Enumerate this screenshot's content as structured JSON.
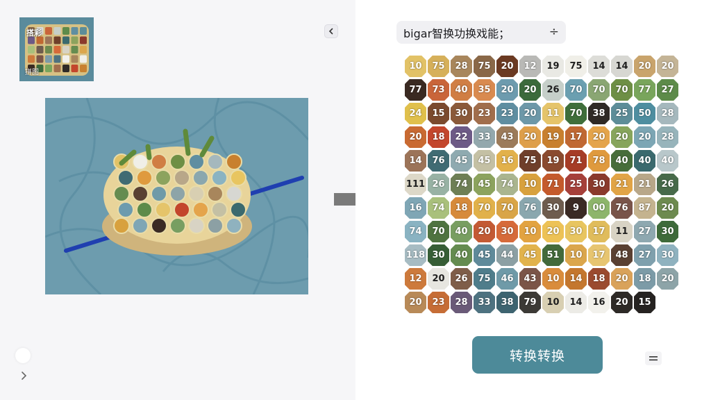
{
  "left_panel": {
    "thumbnail": {
      "caption_top": "搭彩",
      "caption_bottom": "拼图"
    }
  },
  "right_panel": {
    "pill": {
      "text": "bigar智换功换戏能；",
      "plus_icon": "plus-icon"
    },
    "convert_button": {
      "label": "转换转换"
    }
  },
  "bead_grid": {
    "rows": [
      [
        {
          "v": "10",
          "c": "#e2c267"
        },
        {
          "v": "75",
          "c": "#d6b05a"
        },
        {
          "v": "28",
          "c": "#a8865c"
        },
        {
          "v": "75",
          "c": "#8a6848"
        },
        {
          "v": "20",
          "c": "#6b3a22"
        },
        {
          "v": "12",
          "c": "#b9b9b6"
        },
        {
          "v": "19",
          "c": "#e9e9e4"
        },
        {
          "v": "75",
          "c": "#f0efe8"
        },
        {
          "v": "14",
          "c": "#ddddd8"
        },
        {
          "v": "14",
          "c": "#d7d7d2"
        },
        {
          "v": "20",
          "c": "#c9a46c"
        },
        {
          "v": "20",
          "c": "#c4b496"
        }
      ],
      [
        {
          "v": "77",
          "c": "#3a2a22"
        },
        {
          "v": "73",
          "c": "#c9653a"
        },
        {
          "v": "40",
          "c": "#d07e44"
        },
        {
          "v": "35",
          "c": "#d98a4f"
        },
        {
          "v": "20",
          "c": "#6d9bae"
        },
        {
          "v": "20",
          "c": "#3c6a3c"
        },
        {
          "v": "26",
          "c": "#c6cfc9"
        },
        {
          "v": "70",
          "c": "#6b9fb0"
        },
        {
          "v": "70",
          "c": "#8aa673"
        },
        {
          "v": "70",
          "c": "#6e8f45"
        },
        {
          "v": "77",
          "c": "#79a55c"
        },
        {
          "v": "27",
          "c": "#5d8b4a"
        }
      ],
      [
        {
          "v": "24",
          "c": "#e0c04c"
        },
        {
          "v": "15",
          "c": "#7b4a2e"
        },
        {
          "v": "30",
          "c": "#8b5a3a"
        },
        {
          "v": "23",
          "c": "#a16e4c"
        },
        {
          "v": "23",
          "c": "#5f8ea1"
        },
        {
          "v": "20",
          "c": "#6d98a8"
        },
        {
          "v": "11",
          "c": "#e5c46a"
        },
        {
          "v": "70",
          "c": "#3f6e3b"
        },
        {
          "v": "38",
          "c": "#2f2a26"
        },
        {
          "v": "25",
          "c": "#5d8d98"
        },
        {
          "v": "50",
          "c": "#4e8ea0"
        },
        {
          "v": "28",
          "c": "#a5b8bd"
        }
      ],
      [
        {
          "v": "20",
          "c": "#c96a32"
        },
        {
          "v": "18",
          "c": "#c3462c"
        },
        {
          "v": "22",
          "c": "#6d5a86"
        },
        {
          "v": "33",
          "c": "#93a8ad"
        },
        {
          "v": "43",
          "c": "#9c7b5a"
        },
        {
          "v": "20",
          "c": "#de9f4a"
        },
        {
          "v": "19",
          "c": "#c8802f"
        },
        {
          "v": "17",
          "c": "#c06832"
        },
        {
          "v": "20",
          "c": "#e4a44b"
        },
        {
          "v": "20",
          "c": "#87a55c"
        },
        {
          "v": "20",
          "c": "#7ca6b4"
        },
        {
          "v": "28",
          "c": "#97b4bb"
        }
      ],
      [
        {
          "v": "14",
          "c": "#9c7459"
        },
        {
          "v": "76",
          "c": "#406b73"
        },
        {
          "v": "45",
          "c": "#8faab0"
        },
        {
          "v": "45",
          "c": "#c4c0a4"
        },
        {
          "v": "16",
          "c": "#e2b14b"
        },
        {
          "v": "75",
          "c": "#6f3f2b"
        },
        {
          "v": "19",
          "c": "#8a4a2f"
        },
        {
          "v": "71",
          "c": "#a63c26"
        },
        {
          "v": "78",
          "c": "#df9a3e"
        },
        {
          "v": "40",
          "c": "#476d3a"
        },
        {
          "v": "40",
          "c": "#3b6a6e"
        },
        {
          "v": "40",
          "c": "#b8c7ca"
        }
      ],
      [
        {
          "v": "111",
          "c": "#ddd8c8"
        },
        {
          "v": "26",
          "c": "#98b2a4"
        },
        {
          "v": "74",
          "c": "#6e7f55"
        },
        {
          "v": "45",
          "c": "#8ca35e"
        },
        {
          "v": "74",
          "c": "#aab58f"
        },
        {
          "v": "10",
          "c": "#d8a13e"
        },
        {
          "v": "71",
          "c": "#c45a2c"
        },
        {
          "v": "25",
          "c": "#a6403a"
        },
        {
          "v": "30",
          "c": "#8a3a2c"
        },
        {
          "v": "21",
          "c": "#e1a446"
        },
        {
          "v": "21",
          "c": "#b8a789"
        },
        {
          "v": "26",
          "c": "#476a4a"
        }
      ],
      [
        {
          "v": "16",
          "c": "#7fa6b5"
        },
        {
          "v": "74",
          "c": "#a9c07c"
        },
        {
          "v": "18",
          "c": "#d68a3b"
        },
        {
          "v": "70",
          "c": "#e1b14a"
        },
        {
          "v": "70",
          "c": "#d9a547"
        },
        {
          "v": "76",
          "c": "#8aa7ae"
        },
        {
          "v": "30",
          "c": "#6e5c4e"
        },
        {
          "v": "9",
          "c": "#3a2a24"
        },
        {
          "v": "00",
          "c": "#8db56b"
        },
        {
          "v": "76",
          "c": "#79544a"
        },
        {
          "v": "87",
          "c": "#c4b38f"
        },
        {
          "v": "20",
          "c": "#6d8a4f"
        }
      ],
      [
        {
          "v": "74",
          "c": "#8ab3c2"
        },
        {
          "v": "70",
          "c": "#4f7340"
        },
        {
          "v": "40",
          "c": "#789e61"
        },
        {
          "v": "20",
          "c": "#c35a34"
        },
        {
          "v": "30",
          "c": "#d66a3a"
        },
        {
          "v": "10",
          "c": "#e2a341"
        },
        {
          "v": "20",
          "c": "#edc256"
        },
        {
          "v": "30",
          "c": "#e8c560"
        },
        {
          "v": "17",
          "c": "#e0bc5c"
        },
        {
          "v": "11",
          "c": "#d8d3c4"
        },
        {
          "v": "27",
          "c": "#8ea8b0"
        },
        {
          "v": "30",
          "c": "#3e6a3a"
        }
      ],
      [
        {
          "v": "118",
          "c": "#a7bcc3"
        },
        {
          "v": "30",
          "c": "#375e36"
        },
        {
          "v": "40",
          "c": "#658c50"
        },
        {
          "v": "45",
          "c": "#5f8a9a"
        },
        {
          "v": "44",
          "c": "#8ca0a4"
        },
        {
          "v": "45",
          "c": "#e2b34c"
        },
        {
          "v": "51",
          "c": "#436a3b"
        },
        {
          "v": "10",
          "c": "#dba64c"
        },
        {
          "v": "17",
          "c": "#e7c571"
        },
        {
          "v": "48",
          "c": "#5a4032"
        },
        {
          "v": "27",
          "c": "#7fa0ad"
        },
        {
          "v": "30",
          "c": "#8fb2bf"
        }
      ],
      [
        {
          "v": "12",
          "c": "#cd7a3c"
        },
        {
          "v": "20",
          "c": "#e7e6e0"
        },
        {
          "v": "26",
          "c": "#7f5e49"
        },
        {
          "v": "75",
          "c": "#4f7d8b"
        },
        {
          "v": "46",
          "c": "#6f9aa8"
        },
        {
          "v": "43",
          "c": "#7b5548"
        },
        {
          "v": "10",
          "c": "#d98c3c"
        },
        {
          "v": "14",
          "c": "#c4772e"
        },
        {
          "v": "18",
          "c": "#9b4b2f"
        },
        {
          "v": "20",
          "c": "#d9a25a"
        },
        {
          "v": "18",
          "c": "#7c9ba7"
        },
        {
          "v": "20",
          "c": "#8da4a8"
        }
      ],
      [
        {
          "v": "20",
          "c": "#b88a58"
        },
        {
          "v": "23",
          "c": "#c66d36"
        },
        {
          "v": "28",
          "c": "#6a5a78"
        },
        {
          "v": "33",
          "c": "#4e7280"
        },
        {
          "v": "38",
          "c": "#3e6470"
        },
        {
          "v": "79",
          "c": "#3c3a36"
        },
        {
          "v": "10",
          "c": "#d8cfb2"
        },
        {
          "v": "14",
          "c": "#ecebe6"
        },
        {
          "v": "16",
          "c": "#f2f1ec"
        },
        {
          "v": "20",
          "c": "#2e2a27"
        },
        {
          "v": "15",
          "c": "#262321"
        }
      ]
    ]
  },
  "colors": {
    "button": "#4d8a99",
    "pill_bg": "#f0f0f3",
    "arrow": "#7a7a7a",
    "left_bg": "#f6f6f8"
  }
}
